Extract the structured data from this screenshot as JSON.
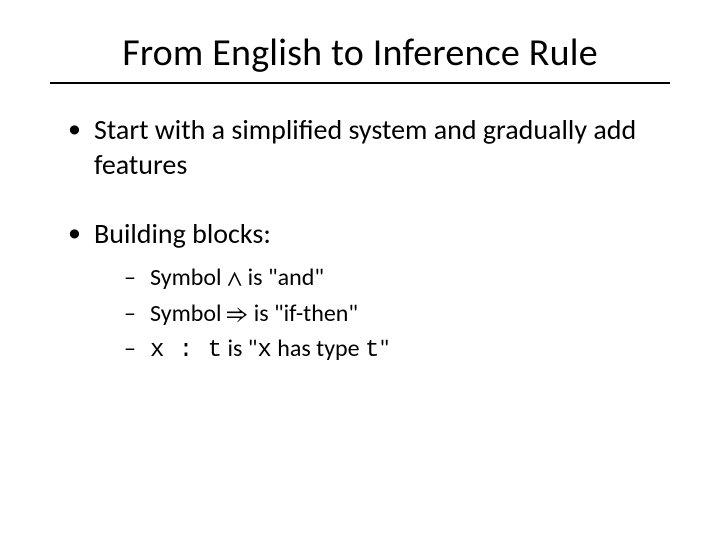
{
  "title": "From English to Inference Rule",
  "bullets": {
    "b1": "Start with a simplified system and gradually add features",
    "b2": "Building blocks:",
    "sub": {
      "s1a": "Symbol ",
      "s1_sym": "∧",
      "s1b": " is \"and\"",
      "s2a": "Symbol ",
      "s2_sym": "⇒",
      "s2b": " is \"if-then\"",
      "s3_x": "x",
      "s3_colon": " : ",
      "s3_t": "t",
      "s3_mid": " is \"",
      "s3_x2": "x",
      "s3_hastype": " has type ",
      "s3_t2": "t",
      "s3_end": "\""
    }
  }
}
